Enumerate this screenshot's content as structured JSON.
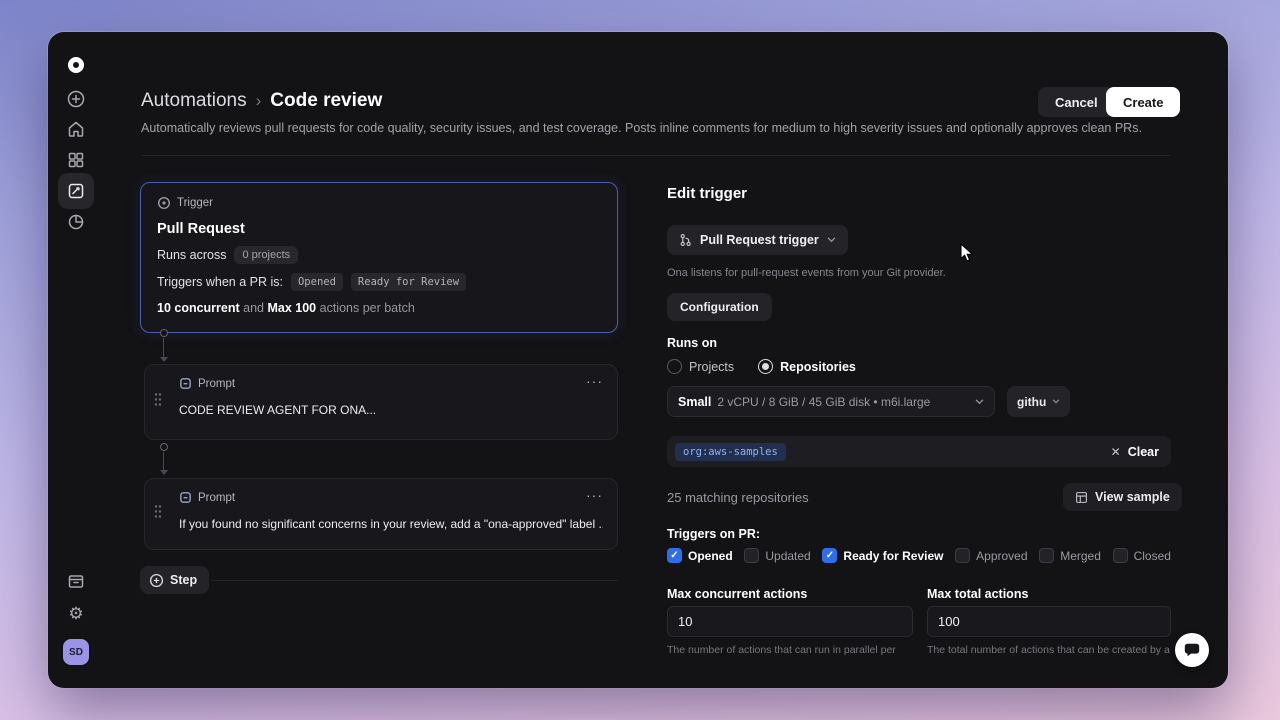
{
  "colors": {
    "accent": "#2f6ee8",
    "chip-bg": "#232f4e",
    "chip-text": "#8fb3f5",
    "trigger-border": "#4b5cae"
  },
  "sidebar": {
    "icons_top": [
      "logo",
      "new",
      "home",
      "projects",
      "automations",
      "usage"
    ],
    "icons_bottom": [
      "environments",
      "settings"
    ],
    "selected": "automations",
    "avatar": "SD"
  },
  "header": {
    "breadcrumb_parent": "Automations",
    "breadcrumb_sep": "›",
    "title": "Code review",
    "description": "Automatically reviews pull requests for code quality, security issues, and test coverage. Posts inline comments for medium to high severity issues and optionally approves clean PRs.",
    "cancel_label": "Cancel",
    "create_label": "Create"
  },
  "workflow": {
    "trigger": {
      "badge": "Trigger",
      "title": "Pull Request",
      "runs_across": "Runs across",
      "projects_badge": "0 projects",
      "triggers_when": "Triggers when a PR is:",
      "status_badges": [
        "Opened",
        "Ready for Review"
      ],
      "batch_parts": [
        "10 concurrent",
        " and ",
        "Max 100",
        " actions per batch"
      ]
    },
    "prompts": [
      {
        "badge": "Prompt",
        "menu": "···",
        "text": "CODE REVIEW AGENT FOR ONA..."
      },
      {
        "badge": "Prompt",
        "menu": "···",
        "text": "If you found no significant concerns in your review, add a \"ona-approved\" label ..."
      }
    ],
    "step_label": "Step"
  },
  "editor": {
    "title": "Edit trigger",
    "trigger_dropdown": "Pull Request trigger",
    "caption": "Ona listens for pull-request events from your Git provider.",
    "tab": "Configuration",
    "runs_on_label": "Runs on",
    "radios": [
      {
        "label": "Projects",
        "selected": false
      },
      {
        "label": "Repositories",
        "selected": true
      }
    ],
    "machine_dropdown": {
      "size": "Small",
      "specs": "2 vCPU / 8 GiB / 45 GiB disk • m6i.large"
    },
    "repo_dropdown": "githu",
    "chip": "org:aws-samples",
    "clear_x": "✕",
    "clear_label": "Clear",
    "matching_text": "25 matching repositories",
    "view_sample_label": "View sample",
    "triggers_on_label": "Triggers on PR:",
    "checkboxes": [
      {
        "label": "Opened",
        "checked": true
      },
      {
        "label": "Updated",
        "checked": false
      },
      {
        "label": "Ready for Review",
        "checked": true
      },
      {
        "label": "Approved",
        "checked": false
      },
      {
        "label": "Merged",
        "checked": false
      },
      {
        "label": "Closed",
        "checked": false
      }
    ],
    "fields": [
      {
        "label": "Max concurrent actions",
        "value": "10",
        "help": "The number of actions that can run in parallel per"
      },
      {
        "label": "Max total actions",
        "value": "100",
        "help": "The total number of actions that can be created by a"
      }
    ]
  }
}
